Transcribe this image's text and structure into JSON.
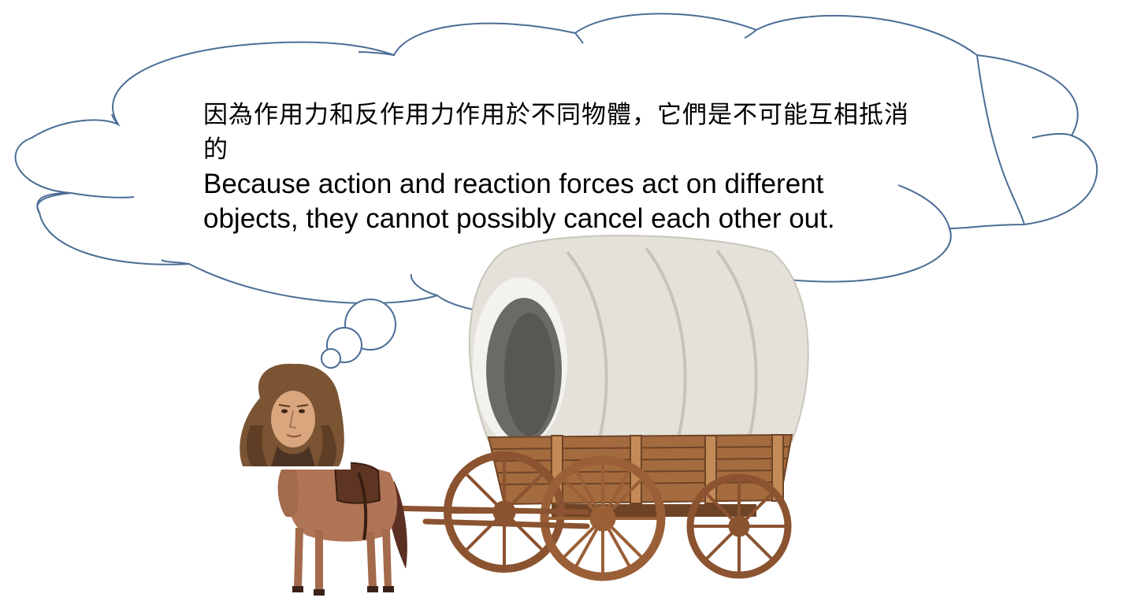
{
  "thought_bubble": {
    "text_zh": "因為作用力和反作用力作用於不同物體，它們是不可能互相抵消的",
    "text_en": "Because action and reaction forces act on different objects, they cannot possibly cancel each other out."
  },
  "colors": {
    "cloud_stroke": "#4b6d96",
    "canvas": "#e3e1d9",
    "wood": "#a46b3f",
    "wheel": "#8b5330",
    "horse": "#b07456",
    "hair": "#7a5433"
  },
  "icons": [
    "thought-cloud-icon",
    "covered-wagon-icon",
    "horse-icon",
    "newton-portrait-icon"
  ]
}
